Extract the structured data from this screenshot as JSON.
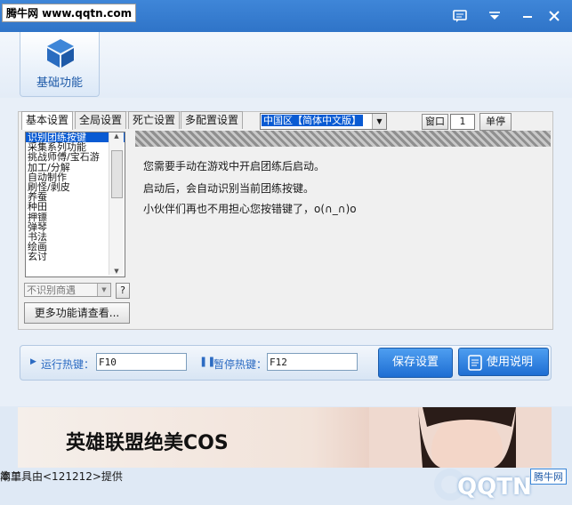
{
  "window": {
    "watermark": "腾牛网 www.qqtn.com"
  },
  "header": {
    "basic_function": "基础功能"
  },
  "tabs": [
    "基本设置",
    "全局设置",
    "死亡设置",
    "多配置设置"
  ],
  "region_select": {
    "value": "中国区【简体中文版】"
  },
  "window_label": "窗口",
  "window_number": "1",
  "single_stop": "单停",
  "function_list": [
    "识别团练按键",
    "采集系列功能",
    "挑战师傅/宝石游",
    "加工/分解",
    "自动制作",
    "刷怪/剥皮",
    "养蚕",
    "种田",
    "押镖",
    "弹琴",
    "书法",
    "绘画",
    "玄讨"
  ],
  "mode_select": {
    "value": "不识别商遇"
  },
  "help_button": "?",
  "more_button": "更多功能请查看...",
  "content_lines": [
    "您需要手动在游戏中开启团练后启动。",
    "启动后，会自动识别当前团练按键。",
    "小伙伴们再也不用担心您按错键了，o(∩_∩)o"
  ],
  "hotkeys": {
    "run_label": "运行热键：",
    "run_value": "F10",
    "pause_label": "暂停热键：",
    "pause_value": "F12"
  },
  "buttons": {
    "save": "保存设置",
    "manual": "使用说明"
  },
  "banner": {
    "text": "英雄联盟绝美COS"
  },
  "footer": {
    "credit": "本工具由<121212>提供",
    "right_text": "简单",
    "brand": "QQTN",
    "brand_tag": "腾牛网"
  },
  "colors": {
    "titlebar": "#2f74c8",
    "accent": "#1e6ed3",
    "selection": "#0a5bd3"
  }
}
